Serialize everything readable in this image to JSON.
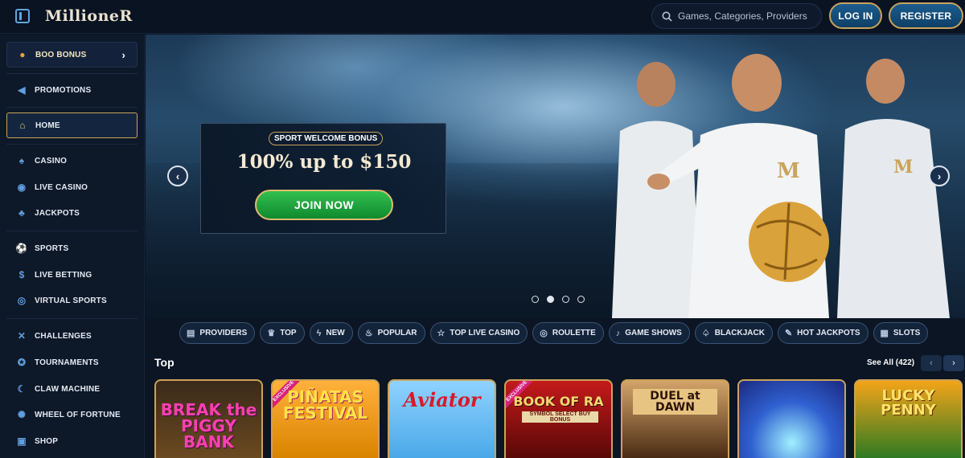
{
  "header": {
    "logo_text": "MillioneR",
    "search_placeholder": "Games, Categories, Providers",
    "login_label": "LOG IN",
    "register_label": "REGISTER"
  },
  "sidebar": {
    "items": [
      {
        "label": "BOO BONUS",
        "icon": "pumpkin-icon"
      },
      {
        "label": "PROMOTIONS",
        "icon": "megaphone-icon"
      },
      {
        "label": "HOME",
        "icon": "home-icon",
        "active": true
      },
      {
        "label": "CASINO",
        "icon": "spade-icon"
      },
      {
        "label": "LIVE CASINO",
        "icon": "chip-icon"
      },
      {
        "label": "JACKPOTS",
        "icon": "clover-icon"
      },
      {
        "label": "SPORTS",
        "icon": "soccer-ball-icon"
      },
      {
        "label": "LIVE BETTING",
        "icon": "live-dollar-icon"
      },
      {
        "label": "VIRTUAL SPORTS",
        "icon": "globe-icon"
      },
      {
        "label": "CHALLENGES",
        "icon": "crossed-swords-icon"
      },
      {
        "label": "TOURNAMENTS",
        "icon": "medal-icon"
      },
      {
        "label": "CLAW MACHINE",
        "icon": "claw-icon"
      },
      {
        "label": "WHEEL OF FORTUNE",
        "icon": "wheel-icon"
      },
      {
        "label": "SHOP",
        "icon": "shopping-bag-icon"
      }
    ]
  },
  "hero": {
    "tag": "SPORT WELCOME BONUS",
    "title": "100% up to $150",
    "cta_label": "JOIN NOW",
    "slide_count": 4,
    "active_slide": 2
  },
  "categories": [
    {
      "label": "PROVIDERS",
      "icon": "book-icon"
    },
    {
      "label": "TOP",
      "icon": "crown-icon"
    },
    {
      "label": "NEW",
      "icon": "lightning-icon"
    },
    {
      "label": "POPULAR",
      "icon": "flame-icon"
    },
    {
      "label": "TOP LIVE CASINO",
      "icon": "star-icon"
    },
    {
      "label": "ROULETTE",
      "icon": "roulette-icon"
    },
    {
      "label": "GAME SHOWS",
      "icon": "microphone-icon"
    },
    {
      "label": "BLACKJACK",
      "icon": "cards-icon"
    },
    {
      "label": "HOT JACKPOTS",
      "icon": "hot-icon"
    },
    {
      "label": "SLOTS",
      "icon": "slot-machine-icon"
    }
  ],
  "top_section": {
    "title": "Top",
    "see_all_label": "See All (422)",
    "games": [
      {
        "title": "BREAK the PIGGY BANK",
        "exclusive": false
      },
      {
        "title": "PIÑATAS FESTIVAL",
        "exclusive": true
      },
      {
        "title": "Aviator",
        "exclusive": false
      },
      {
        "title": "BOOK OF RA",
        "subtitle": "SYMBOL SELECT BUY BONUS",
        "exclusive": true
      },
      {
        "title": "DUEL at DAWN",
        "exclusive": false
      },
      {
        "title": "",
        "exclusive": false
      },
      {
        "title": "LUCKY PENNY",
        "exclusive": false
      }
    ]
  },
  "colors": {
    "gold_border": "#caa35a",
    "join_green": "#1fa53e",
    "accent_blue": "#5f9fe0"
  }
}
